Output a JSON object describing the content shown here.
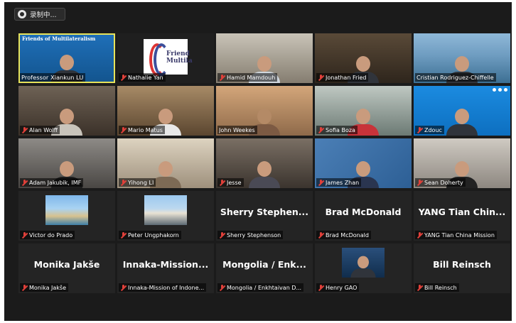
{
  "recording": {
    "label": "录制中..."
  },
  "tiles": [
    {
      "name": "Professor Xiankun LU",
      "brand": "Friends of Multilateralism",
      "muted": false,
      "active": true
    },
    {
      "name": "Nathalie Yan",
      "logo": "Friend Multila",
      "muted": true
    },
    {
      "name": "Hamid Mamdouh",
      "muted": true
    },
    {
      "name": "Jonathan Fried",
      "muted": true
    },
    {
      "name": "Cristian Rodriguez-Chiffelle",
      "muted": false
    },
    {
      "name": "Alan Wolff",
      "muted": true
    },
    {
      "name": "Mario Matus",
      "muted": true
    },
    {
      "name": "John Weekes",
      "muted": false
    },
    {
      "name": "Sofia Boza",
      "muted": true
    },
    {
      "name": "Zdouc",
      "muted": true
    },
    {
      "name": "Adam Jakubik, IMF",
      "muted": true
    },
    {
      "name": "Yihong LI",
      "muted": true
    },
    {
      "name": "Jesse",
      "muted": true
    },
    {
      "name": "James Zhan",
      "muted": true
    },
    {
      "name": "Sean Doherty",
      "muted": true
    },
    {
      "name": "Victor do Prado",
      "muted": true
    },
    {
      "name": "Peter Ungphakorn",
      "muted": true
    },
    {
      "name": "Sherry Stephenson",
      "big_label": "Sherry Stephen...",
      "muted": true
    },
    {
      "name": "Brad McDonald",
      "big_label": "Brad McDonald",
      "muted": true
    },
    {
      "name": "YANG Tian China Mission",
      "big_label": "YANG Tian Chin...",
      "muted": true
    },
    {
      "name": "Monika Jakše",
      "big_label": "Monika Jakše",
      "muted": true
    },
    {
      "name": "Innaka-Mission of Indone...",
      "big_label": "Innaka-Mission...",
      "muted": true
    },
    {
      "name": "Mongolia / Enkhtaivan D...",
      "big_label": "Mongolia / Enk...",
      "muted": true
    },
    {
      "name": "Henry GAO",
      "muted": true
    },
    {
      "name": "Bill Reinsch",
      "big_label": "Bill Reinsch",
      "muted": true
    }
  ]
}
